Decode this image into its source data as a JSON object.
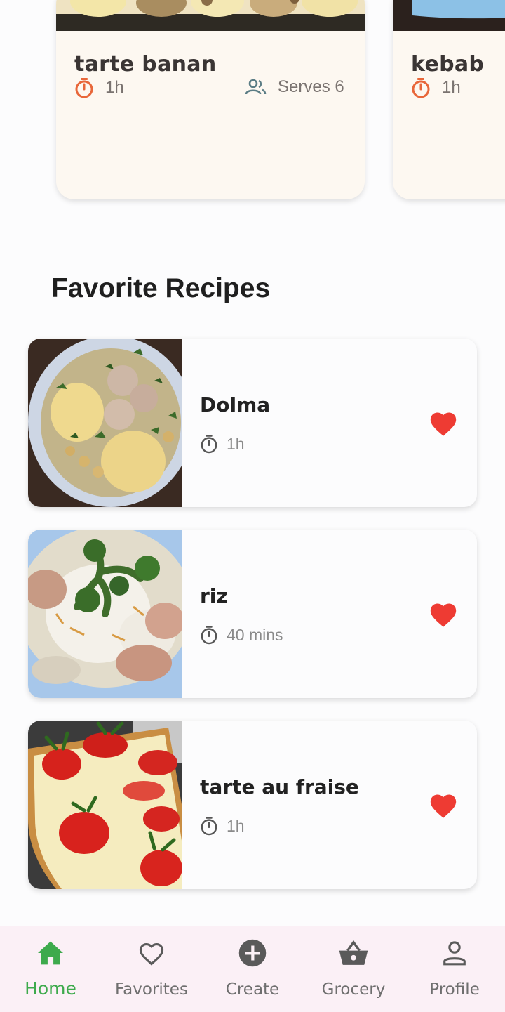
{
  "top_cards": [
    {
      "title": "tarte banan",
      "time": "1h",
      "serves": "Serves 6"
    },
    {
      "title": "kebab",
      "time": "1h"
    }
  ],
  "section": {
    "title": "Favorite Recipes"
  },
  "favorites": [
    {
      "name": "Dolma",
      "time": "1h"
    },
    {
      "name": "riz",
      "time": "40 mins"
    },
    {
      "name": "tarte au fraise",
      "time": "1h"
    }
  ],
  "nav": {
    "items": [
      {
        "label": "Home",
        "icon": "home-icon",
        "active": true
      },
      {
        "label": "Favorites",
        "icon": "heart-outline-icon"
      },
      {
        "label": "Create",
        "icon": "add-circle-icon"
      },
      {
        "label": "Grocery",
        "icon": "basket-icon"
      },
      {
        "label": "Profile",
        "icon": "person-icon"
      }
    ]
  },
  "colors": {
    "accent": "#3daa4c",
    "timer_orange": "#e8673a",
    "heart_red": "#ee3b33",
    "card_bg": "#fdf8f1"
  }
}
